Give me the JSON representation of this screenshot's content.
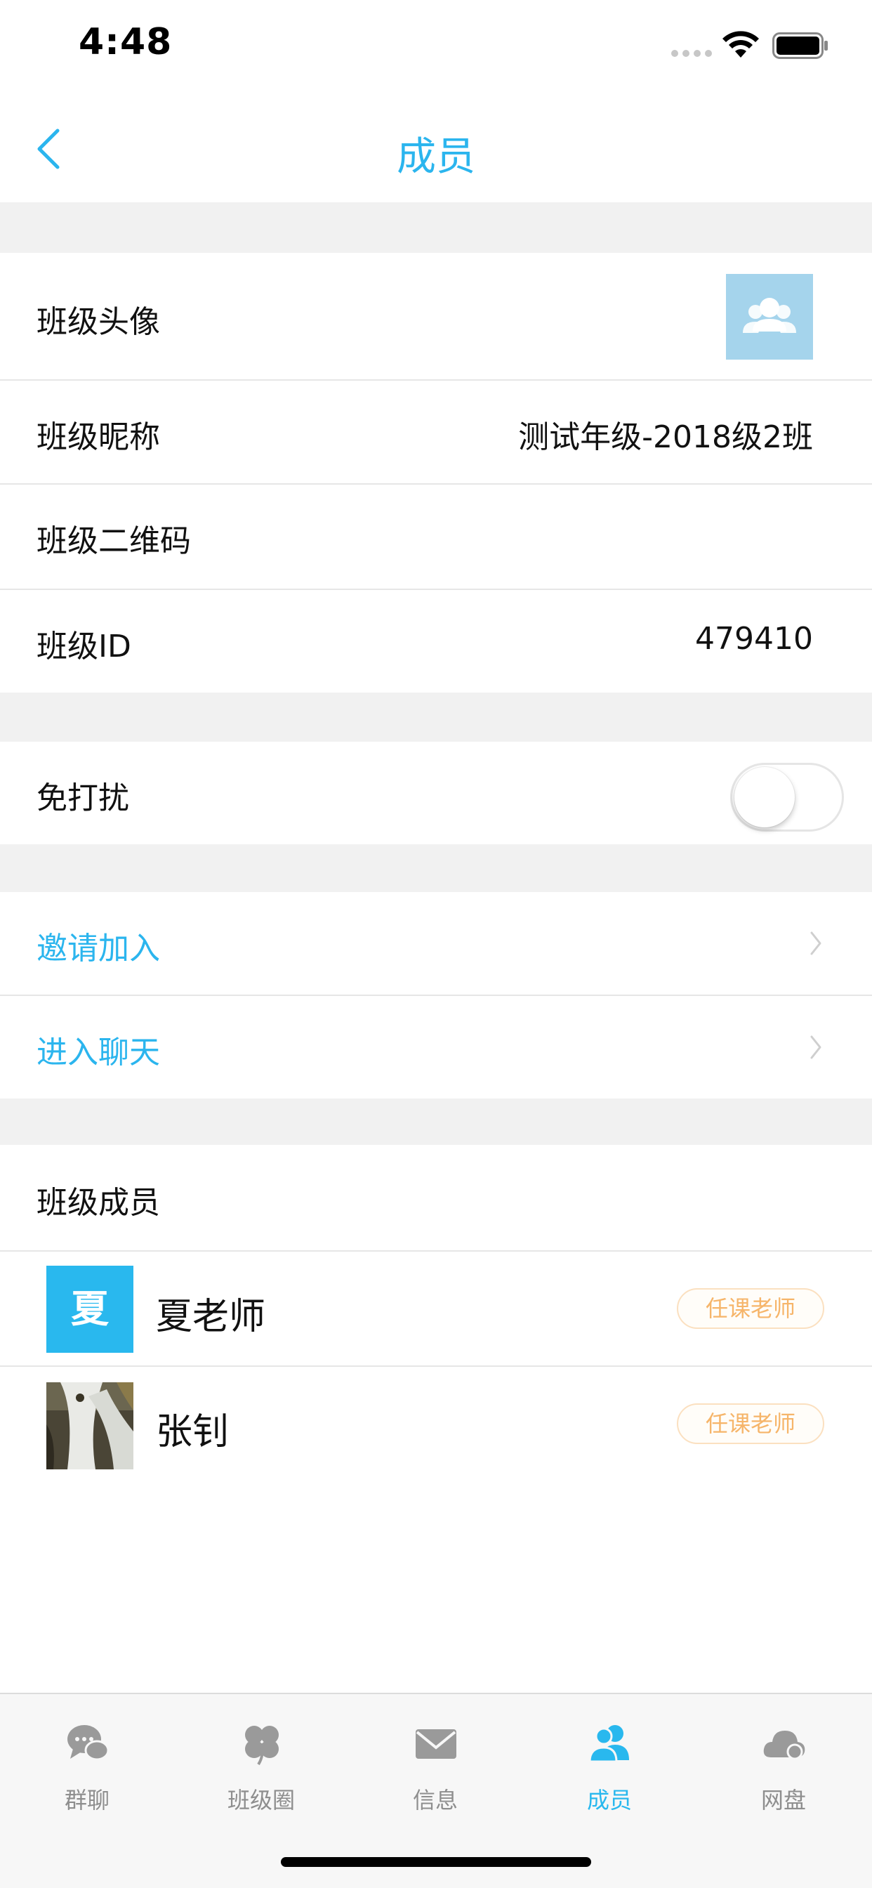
{
  "status_bar": {
    "time": "4:48"
  },
  "nav": {
    "title": "成员"
  },
  "settings": {
    "avatar_label": "班级头像",
    "nickname_label": "班级昵称",
    "nickname_value": "测试年级-2018级2班",
    "qrcode_label": "班级二维码",
    "id_label": "班级ID",
    "id_value": "479410",
    "dnd_label": "免打扰",
    "dnd_on": false
  },
  "actions": {
    "invite_label": "邀请加入",
    "chat_label": "进入聊天"
  },
  "members": {
    "header": "班级成员",
    "list": [
      {
        "avatar_text": "夏",
        "name": "夏老师",
        "role": "任课老师"
      },
      {
        "avatar_text": "",
        "name": "张钊",
        "role": "任课老师"
      }
    ]
  },
  "tabs": [
    {
      "label": "群聊",
      "icon": "chat-bubbles-icon",
      "active": false
    },
    {
      "label": "班级圈",
      "icon": "clover-icon",
      "active": false
    },
    {
      "label": "信息",
      "icon": "envelope-icon",
      "active": false
    },
    {
      "label": "成员",
      "icon": "members-icon",
      "active": true
    },
    {
      "label": "网盘",
      "icon": "cloud-icon",
      "active": false
    }
  ],
  "colors": {
    "accent": "#2bb5ee",
    "badge_text": "#f6b56a",
    "badge_border": "#fbe0c0",
    "group_bg": "#f1f1f1",
    "class_avatar_bg": "#a5d4ec"
  }
}
